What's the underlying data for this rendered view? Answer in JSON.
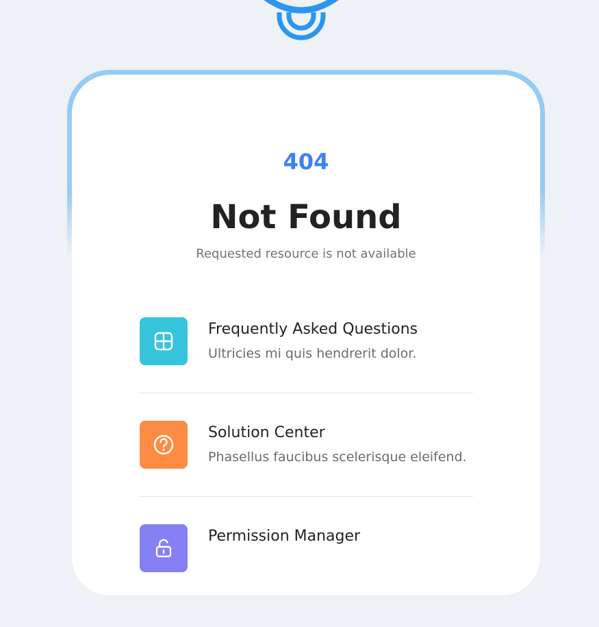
{
  "error": {
    "code": "404",
    "title": "Not Found",
    "message": "Requested resource is not available"
  },
  "links": [
    {
      "title": "Frequently Asked Questions",
      "description": "Ultricies mi quis hendrerit dolor.",
      "icon": "grid-icon",
      "color": "#36c5dc"
    },
    {
      "title": "Solution Center",
      "description": "Phasellus faucibus scelerisque eleifend.",
      "icon": "help-circle-icon",
      "color": "#fc8c43"
    },
    {
      "title": "Permission Manager",
      "description": "",
      "icon": "unlock-icon",
      "color": "#8580f3"
    }
  ],
  "colors": {
    "accent": "#3b82f6",
    "background": "#eef1f6",
    "card_border": "#96cbf4",
    "logo": "#2b95f0"
  }
}
